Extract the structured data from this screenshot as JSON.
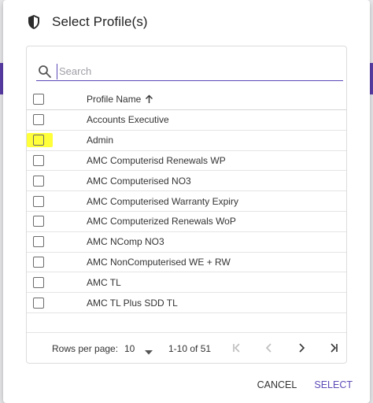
{
  "dialog": {
    "title": "Select Profile(s)",
    "icon": "shield-icon"
  },
  "search": {
    "placeholder": "Search",
    "value": ""
  },
  "table": {
    "header": {
      "name": "Profile Name",
      "sort": "ascending"
    },
    "rows": [
      "Accounts Executive",
      "Admin",
      "AMC Computerisd Renewals WP",
      "AMC Computerised NO3",
      "AMC Computerised Warranty Expiry",
      "AMC Computerized Renewals WoP",
      "AMC NComp NO3",
      "AMC NonComputerised WE + RW",
      "AMC TL",
      "AMC TL Plus SDD TL"
    ]
  },
  "pagination": {
    "rows_per_page_label": "Rows per page:",
    "rows_per_page": "10",
    "range": "1-10 of 51"
  },
  "actions": {
    "cancel": "CANCEL",
    "select": "SELECT"
  },
  "colors": {
    "accent": "#5b4bb7",
    "highlight": "#ffff3a"
  }
}
